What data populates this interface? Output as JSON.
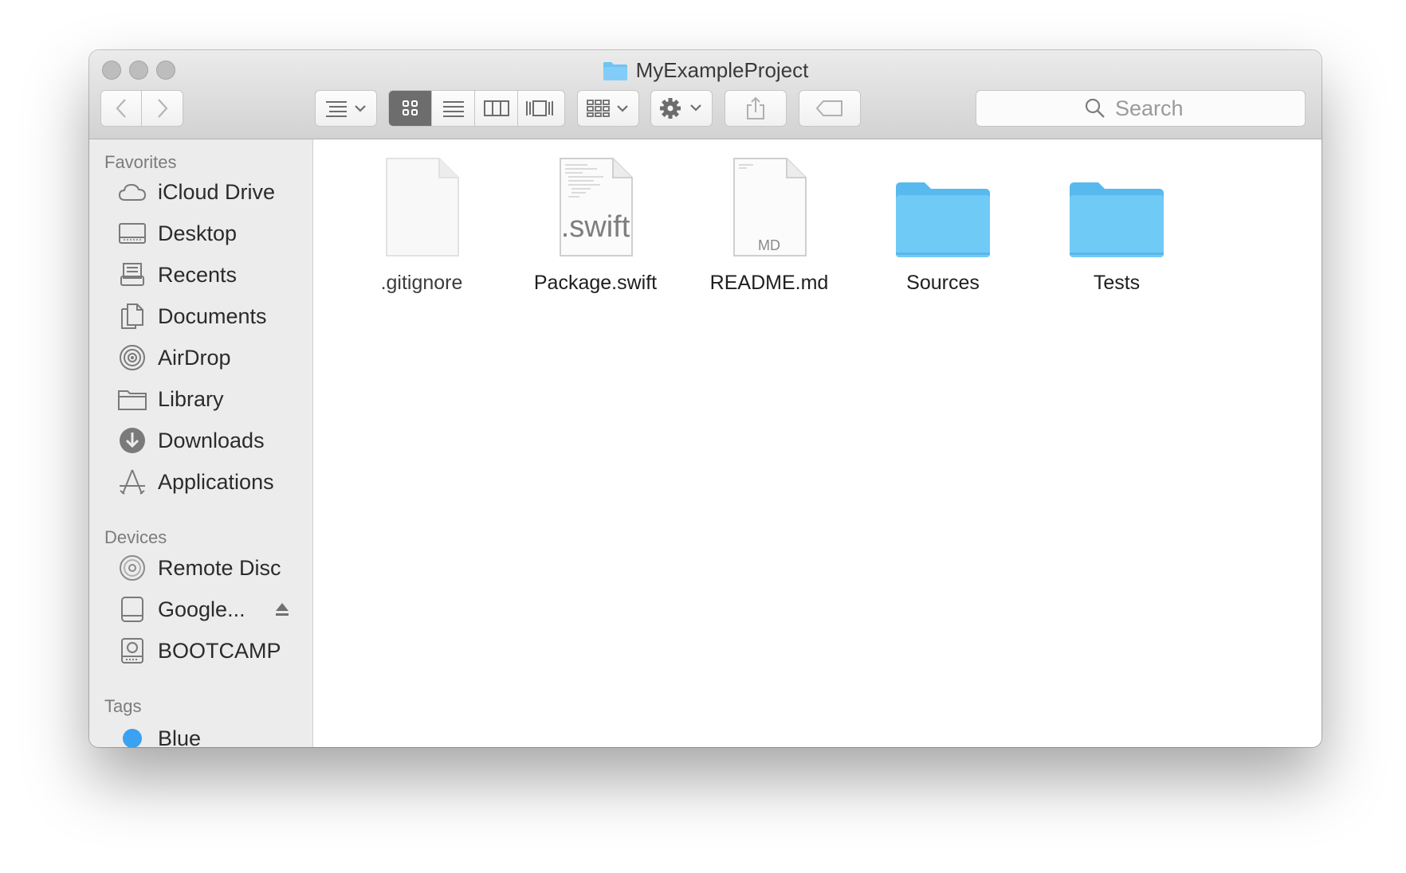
{
  "window": {
    "title": "MyExampleProject"
  },
  "toolbar": {
    "search_placeholder": "Search",
    "view_modes": [
      "icon-view",
      "list-view",
      "column-view",
      "cover-flow-view"
    ],
    "active_view": "icon-view"
  },
  "sidebar": {
    "favorites_label": "Favorites",
    "favorites": [
      {
        "label": "iCloud Drive",
        "icon": "cloud-icon"
      },
      {
        "label": "Desktop",
        "icon": "desktop-icon"
      },
      {
        "label": "Recents",
        "icon": "recents-icon"
      },
      {
        "label": "Documents",
        "icon": "documents-icon"
      },
      {
        "label": "AirDrop",
        "icon": "airdrop-icon"
      },
      {
        "label": "Library",
        "icon": "folder-icon"
      },
      {
        "label": "Downloads",
        "icon": "downloads-icon"
      },
      {
        "label": "Applications",
        "icon": "applications-icon"
      }
    ],
    "devices_label": "Devices",
    "devices": [
      {
        "label": "Remote Disc",
        "icon": "disc-icon"
      },
      {
        "label": "Google...",
        "icon": "drive-icon"
      },
      {
        "label": "BOOTCAMP",
        "icon": "hard-drive-icon"
      }
    ],
    "tags_label": "Tags",
    "tags": [
      {
        "label": "Blue",
        "color": "#3aa2f0"
      }
    ]
  },
  "files": [
    {
      "name": ".gitignore",
      "kind": "blank-file-icon"
    },
    {
      "name": "Package.swift",
      "kind": "swift-file-icon",
      "badge": ".swift"
    },
    {
      "name": "README.md",
      "kind": "markdown-file-icon",
      "badge": "MD"
    },
    {
      "name": "Sources",
      "kind": "folder-icon"
    },
    {
      "name": "Tests",
      "kind": "folder-icon"
    }
  ],
  "colors": {
    "folder": "#5fc0f5",
    "accent": "#3aa2f0"
  }
}
